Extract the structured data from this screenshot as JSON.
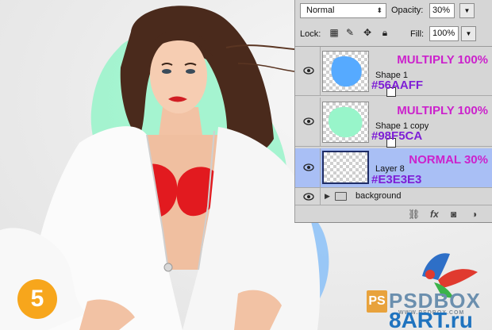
{
  "step": {
    "number": "5"
  },
  "colors": {
    "blob_blue": "#56AAFF",
    "blob_mint": "#98F5CA",
    "background_layer": "#E3E3E3",
    "mode_text": "#CC22CC",
    "hex_text": "#7E1FD6",
    "badge": "#F7A61C"
  },
  "layers_panel": {
    "blend_mode": "Normal",
    "opacity_label": "Opacity:",
    "opacity_value": "30%",
    "lock_label": "Lock:",
    "fill_label": "Fill:",
    "fill_value": "100%",
    "lock_icons": [
      "checker-lock-icon",
      "brush-lock-icon",
      "move-lock-icon",
      "padlock-icon"
    ],
    "layers": [
      {
        "name": "Shape 1",
        "mode": "MULTIPLY 100%",
        "hex": "#56AAFF",
        "thumb_color": "#56AAFF",
        "selected": false,
        "has_mask_icon": true
      },
      {
        "name": "Shape 1 copy",
        "mode": "MULTIPLY 100%",
        "hex": "#98F5CA",
        "thumb_color": "#98F5CA",
        "selected": false,
        "has_mask_icon": true
      },
      {
        "name": "Layer 8",
        "mode": "NORMAL 30%",
        "hex": "#E3E3E3",
        "thumb_color": "",
        "selected": true,
        "has_mask_icon": false
      }
    ],
    "group": {
      "name": "background",
      "collapsed": true
    },
    "footer_icons": [
      "link-icon",
      "fx-icon",
      "mask-icon",
      "adjustment-icon"
    ],
    "footer_fx": "fx"
  },
  "watermark": {
    "ps": "PS",
    "psdbox": "PSDBOX",
    "url": "WWW.PSDBOX.COM",
    "art_main": "8ART",
    "art_suffix": ".ru"
  }
}
